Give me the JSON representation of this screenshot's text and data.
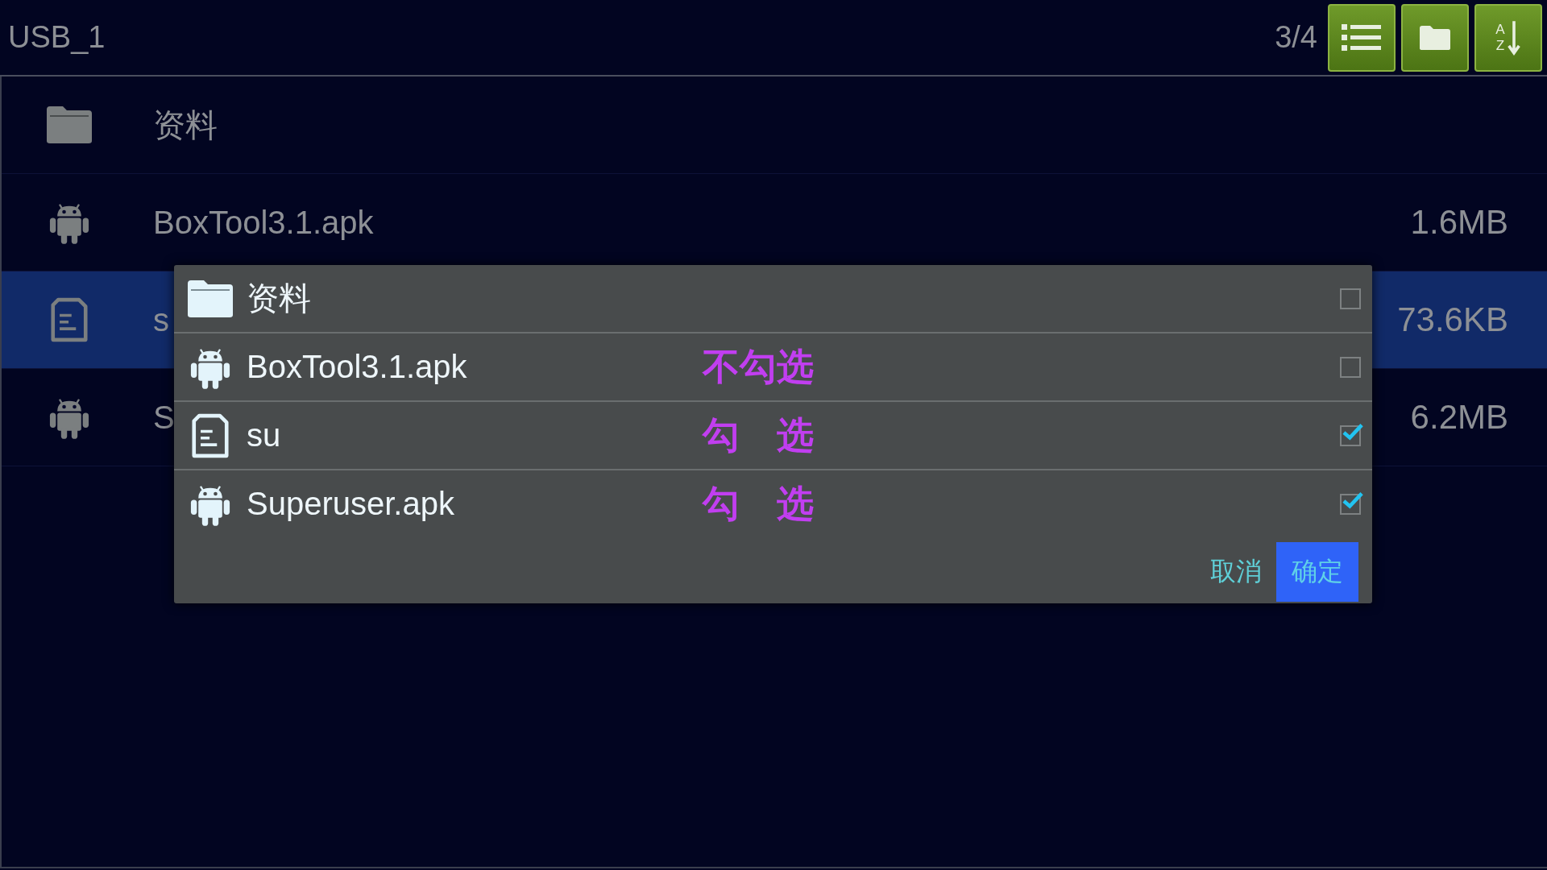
{
  "header": {
    "title": "USB_1",
    "page_count": "3/4",
    "sort_letters": {
      "top": "A",
      "bottom": "Z"
    }
  },
  "files": [
    {
      "kind": "folder",
      "name": "资料",
      "selected": false
    },
    {
      "kind": "apk",
      "name": "BoxTool3.1.apk",
      "size": "1.6MB",
      "selected": false
    },
    {
      "kind": "document",
      "name": "s",
      "size": "73.6KB",
      "selected": true
    },
    {
      "kind": "apk",
      "name": "S",
      "size": "6.2MB",
      "selected": false
    }
  ],
  "dialog": {
    "items": [
      {
        "kind": "folder",
        "name": "资料",
        "checked": false
      },
      {
        "kind": "apk",
        "name": "BoxTool3.1.apk",
        "checked": false,
        "annotation": "不勾选"
      },
      {
        "kind": "document",
        "name": "su",
        "checked": true,
        "annotation": "勾　选"
      },
      {
        "kind": "apk",
        "name": "Superuser.apk",
        "checked": true,
        "annotation": "勾　选"
      }
    ],
    "cancel": "取消",
    "confirm": "确定"
  }
}
